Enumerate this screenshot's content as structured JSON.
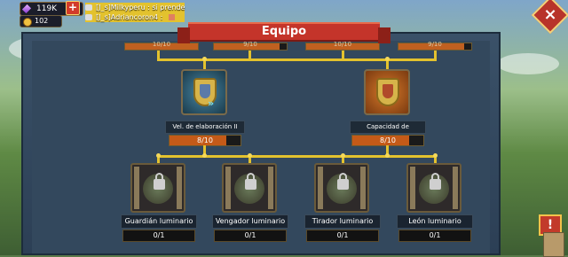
{
  "hud": {
    "gems": "119K",
    "plus": "+",
    "coins": "102"
  },
  "chat": [
    {
      "text": "[J_s]Milkyperu : si prende"
    },
    {
      "text": "[J_s]Adriancoron4 :"
    }
  ],
  "close_label": "×",
  "title": "Equipo",
  "top_bars": [
    {
      "label": "10/10",
      "fill": 1.0
    },
    {
      "label": "9/10",
      "fill": 0.9
    },
    {
      "label": "10/10",
      "fill": 1.0
    },
    {
      "label": "9/10",
      "fill": 0.9
    }
  ],
  "upper_nodes": [
    {
      "label": "Vel. de elaboración II",
      "progress": "8/10",
      "fill": 0.8,
      "icon": "shield-speed-icon"
    },
    {
      "label": "Capacidad de elaboración I",
      "progress": "8/10",
      "fill": 0.8,
      "icon": "shield-capacity-icon"
    }
  ],
  "lower_nodes": [
    {
      "label": "Guardián luminario",
      "progress": "0/1",
      "icon": "locked-hero-icon"
    },
    {
      "label": "Vengador luminario",
      "progress": "0/1",
      "icon": "locked-hero-icon"
    },
    {
      "label": "Tirador luminario",
      "progress": "0/1",
      "icon": "locked-hero-icon"
    },
    {
      "label": "León luminario",
      "progress": "0/1",
      "icon": "locked-hero-icon"
    }
  ],
  "side_button": "!",
  "colors": {
    "banner": "#c4342a",
    "connector": "#e3c22e",
    "progress_fill": "#c45a18"
  }
}
